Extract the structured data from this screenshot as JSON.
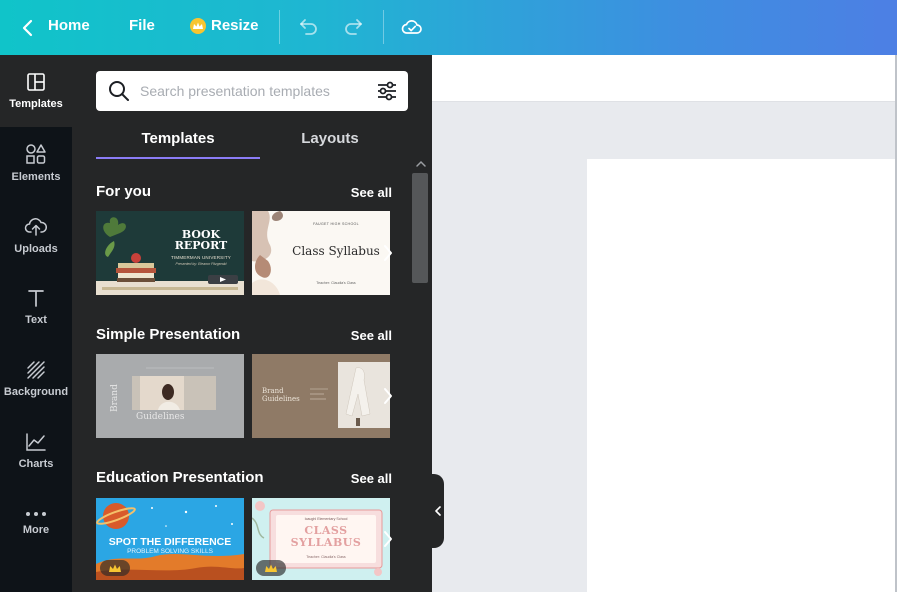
{
  "topbar": {
    "home_label": "Home",
    "file_label": "File",
    "resize_label": "Resize"
  },
  "rail": {
    "items": [
      {
        "label": "Templates",
        "icon": "templates-icon",
        "active": true
      },
      {
        "label": "Elements",
        "icon": "elements-icon"
      },
      {
        "label": "Uploads",
        "icon": "upload-cloud-icon"
      },
      {
        "label": "Text",
        "icon": "text-icon"
      },
      {
        "label": "Background",
        "icon": "background-icon"
      },
      {
        "label": "Charts",
        "icon": "chart-icon"
      },
      {
        "label": "More",
        "icon": "more-icon"
      }
    ]
  },
  "search": {
    "placeholder": "Search presentation templates",
    "value": ""
  },
  "tabs": [
    {
      "label": "Templates",
      "active": true
    },
    {
      "label": "Layouts"
    }
  ],
  "sections": [
    {
      "title": "For you",
      "see_all": "See all",
      "thumbs": [
        {
          "title": "BOOK REPORT",
          "subtitle": "TIMMERMAN UNIVERSITY",
          "caption": "Presented by: Eleanor Fitzgerald"
        },
        {
          "header": "FAUGET HIGH SCHOOL",
          "title": "Class Syllabus",
          "footer": "Teacher: Claudia's Class"
        }
      ]
    },
    {
      "title": "Simple Presentation",
      "see_all": "See all",
      "thumbs": [
        {
          "title_a": "Brand",
          "title_b": "Guidelines"
        },
        {
          "title": "Brand Guidelines"
        }
      ]
    },
    {
      "title": "Education Presentation",
      "see_all": "See all",
      "thumbs": [
        {
          "title": "SPOT THE DIFFERENCE",
          "subtitle": "PROBLEM SOLVING SKILLS"
        },
        {
          "header": "Icaughl Elementary School",
          "title_a": "CLASS",
          "title_b": "SYLLABUS",
          "footer": "Teacher: Claudia's Class"
        }
      ]
    }
  ],
  "colors": {
    "topbar_start": "#10c4c9",
    "topbar_end": "#4d7fe4",
    "tab_underline": "#8b7cf6",
    "panel_bg": "#252627",
    "rail_bg": "#0e1318",
    "crown": "#f7c531"
  }
}
